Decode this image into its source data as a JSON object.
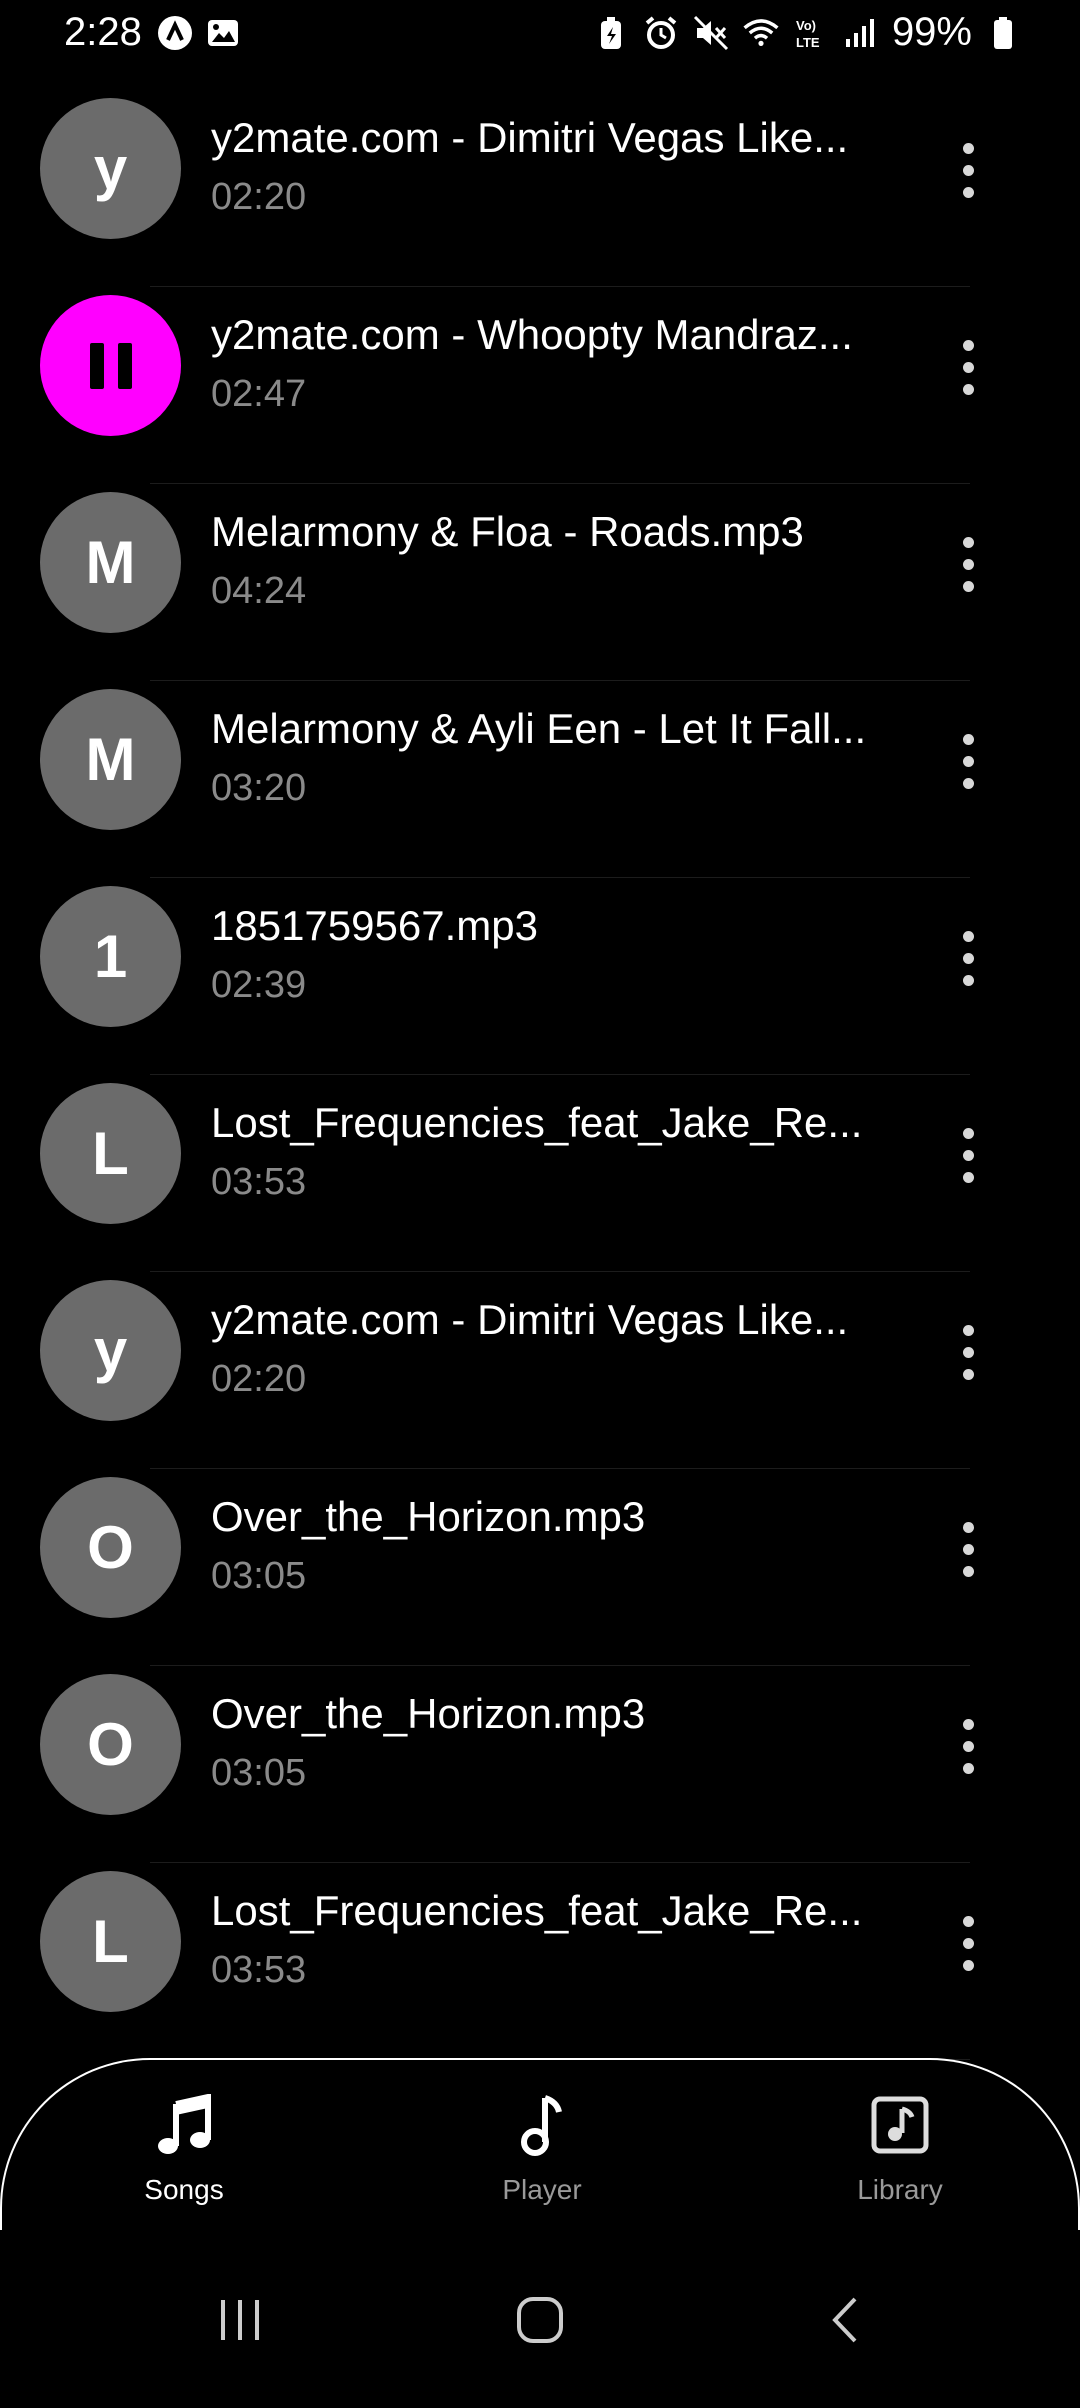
{
  "status_bar": {
    "time": "2:28",
    "battery_percent": "99%",
    "left_icons": [
      "app-a-icon",
      "gallery-icon"
    ],
    "right_icons": [
      "battery-saver-icon",
      "alarm-icon",
      "mute-icon",
      "wifi-icon",
      "volte-icon",
      "signal-icon",
      "battery-icon"
    ]
  },
  "songs": [
    {
      "initial": "y",
      "title": "y2mate.com - Dimitri Vegas  Like...",
      "duration": "02:20",
      "playing": false
    },
    {
      "initial": "",
      "title": "y2mate.com - Whoopty Mandraz...",
      "duration": "02:47",
      "playing": true
    },
    {
      "initial": "M",
      "title": "Melarmony & Floa - Roads.mp3",
      "duration": "04:24",
      "playing": false
    },
    {
      "initial": "M",
      "title": "Melarmony & Ayli Een - Let It Fall...",
      "duration": "03:20",
      "playing": false
    },
    {
      "initial": "1",
      "title": "1851759567.mp3",
      "duration": "02:39",
      "playing": false
    },
    {
      "initial": "L",
      "title": "Lost_Frequencies_feat_Jake_Re...",
      "duration": "03:53",
      "playing": false
    },
    {
      "initial": "y",
      "title": "y2mate.com - Dimitri Vegas  Like...",
      "duration": "02:20",
      "playing": false
    },
    {
      "initial": "O",
      "title": "Over_the_Horizon.mp3",
      "duration": "03:05",
      "playing": false
    },
    {
      "initial": "O",
      "title": "Over_the_Horizon.mp3",
      "duration": "03:05",
      "playing": false
    },
    {
      "initial": "L",
      "title": "Lost_Frequencies_feat_Jake_Re...",
      "duration": "03:53",
      "playing": false
    }
  ],
  "bottom_nav": {
    "songs_label": "Songs",
    "player_label": "Player",
    "library_label": "Library",
    "active": "Songs"
  },
  "colors": {
    "accent": "#ff00ff",
    "avatar": "#6b6b6b",
    "background": "#000000",
    "secondary_text": "#8a8a8a"
  }
}
